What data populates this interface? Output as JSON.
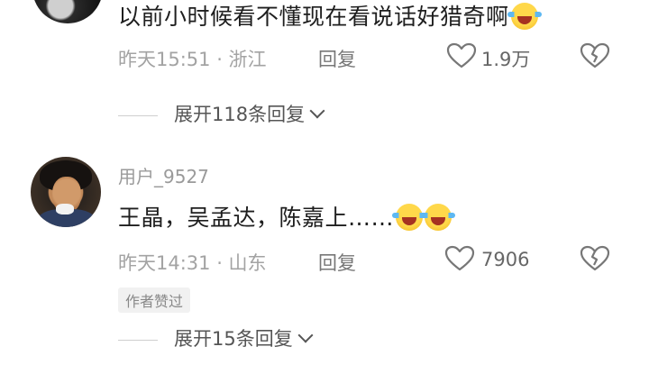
{
  "comments": [
    {
      "text": "以前小时候看不懂现在看说话好猎奇啊",
      "emoji_count": 1,
      "time": "昨天15:51 · 浙江",
      "reply_label": "回复",
      "likes": "1.9万",
      "expand_label": "展开118条回复"
    },
    {
      "username": "用户_9527",
      "text": "王晶，吴孟达，陈嘉上……",
      "emoji_count": 2,
      "time": "昨天14:31 · 山东",
      "reply_label": "回复",
      "likes": "7906",
      "badge": "作者赞过",
      "expand_label": "展开15条回复"
    }
  ],
  "icons": {
    "like": "heart-outline-icon",
    "dislike": "broken-heart-icon",
    "emoji": "laughing-crying-emoji",
    "expand": "chevron-down-icon"
  },
  "colors": {
    "primary_text": "#1e1e1e",
    "secondary_text": "#a3a3a3",
    "background": "#ffffff"
  }
}
